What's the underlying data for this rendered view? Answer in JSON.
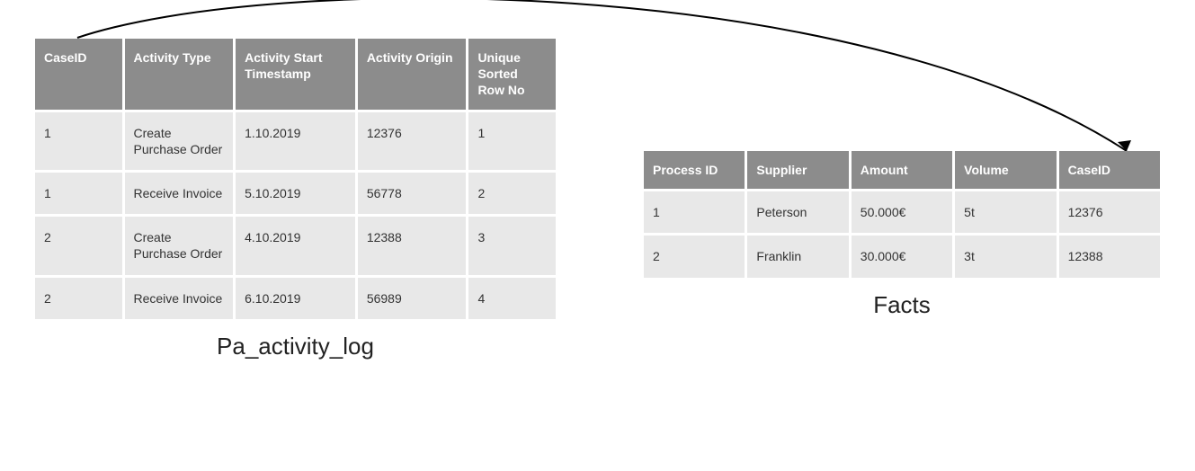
{
  "left_table": {
    "caption": "Pa_activity_log",
    "headers": [
      "CaseID",
      "Activity Type",
      "Activity Start Timestamp",
      "Activity Origin",
      "Unique Sorted Row No"
    ],
    "rows": [
      [
        "1",
        "Create Purchase Order",
        "1.10.2019",
        "12376",
        "1"
      ],
      [
        "1",
        "Receive Invoice",
        "5.10.2019",
        "56778",
        "2"
      ],
      [
        "2",
        "Create Purchase Order",
        "4.10.2019",
        "12388",
        "3"
      ],
      [
        "2",
        "Receive Invoice",
        "6.10.2019",
        "56989",
        "4"
      ]
    ]
  },
  "right_table": {
    "caption": "Facts",
    "headers": [
      "Process ID",
      "Supplier",
      "Amount",
      "Volume",
      "CaseID"
    ],
    "rows": [
      [
        "1",
        "Peterson",
        "50.000€",
        "5t",
        "12376"
      ],
      [
        "2",
        "Franklin",
        "30.000€",
        "3t",
        "12388"
      ]
    ]
  }
}
